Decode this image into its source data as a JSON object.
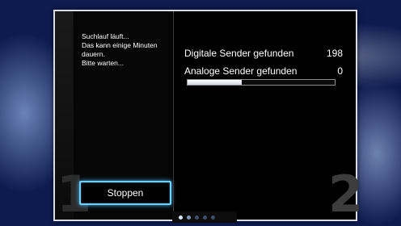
{
  "wizard": {
    "message_lines": [
      "Suchlauf läuft...",
      "Das kann einige Minuten",
      "dauern.",
      "Bitte warten..."
    ],
    "stop_button_label": "Stoppen",
    "step_left": "1",
    "step_right": "2"
  },
  "results": {
    "digital_label": "Digitale Sender gefunden",
    "digital_count": "198",
    "analog_label": "Analoge Sender gefunden",
    "analog_count": "0"
  },
  "progress": {
    "fraction": 0.37
  },
  "pager": {
    "total": 5,
    "active_index": 0
  },
  "colors": {
    "accent_focus": "#6fd0ff",
    "panel_bg": "#000000",
    "text": "#ffffff"
  }
}
